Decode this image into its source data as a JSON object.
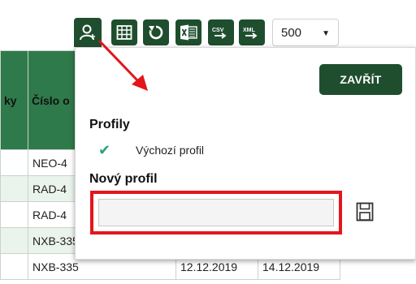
{
  "toolbar": {
    "icons": [
      "user-profile-icon",
      "grid-columns-icon",
      "reset-icon",
      "excel-export-icon",
      "csv-export-icon",
      "xml-export-icon"
    ],
    "csv_text": "CSV",
    "xml_text": "XML",
    "page_size_value": "500"
  },
  "table": {
    "headers": [
      "ky",
      "Číslo o"
    ],
    "rows": [
      [
        "NEO-4",
        "",
        ""
      ],
      [
        "RAD-4",
        "",
        ""
      ],
      [
        "RAD-4",
        "",
        ""
      ],
      [
        "NXB-335",
        "",
        ""
      ],
      [
        "NXB-335",
        "12.12.2019",
        "14.12.2019"
      ]
    ]
  },
  "popup": {
    "close_label": "ZAVŘÍT",
    "profiles_title": "Profily",
    "default_profile": "Výchozí profil",
    "new_profile_title": "Nový profil",
    "new_profile_value": "",
    "new_profile_placeholder": ""
  },
  "colors": {
    "dark_green": "#1f4e2e",
    "header_green": "#2f7a4a",
    "highlight_red": "#e3161b",
    "check_teal": "#2aa37a"
  }
}
